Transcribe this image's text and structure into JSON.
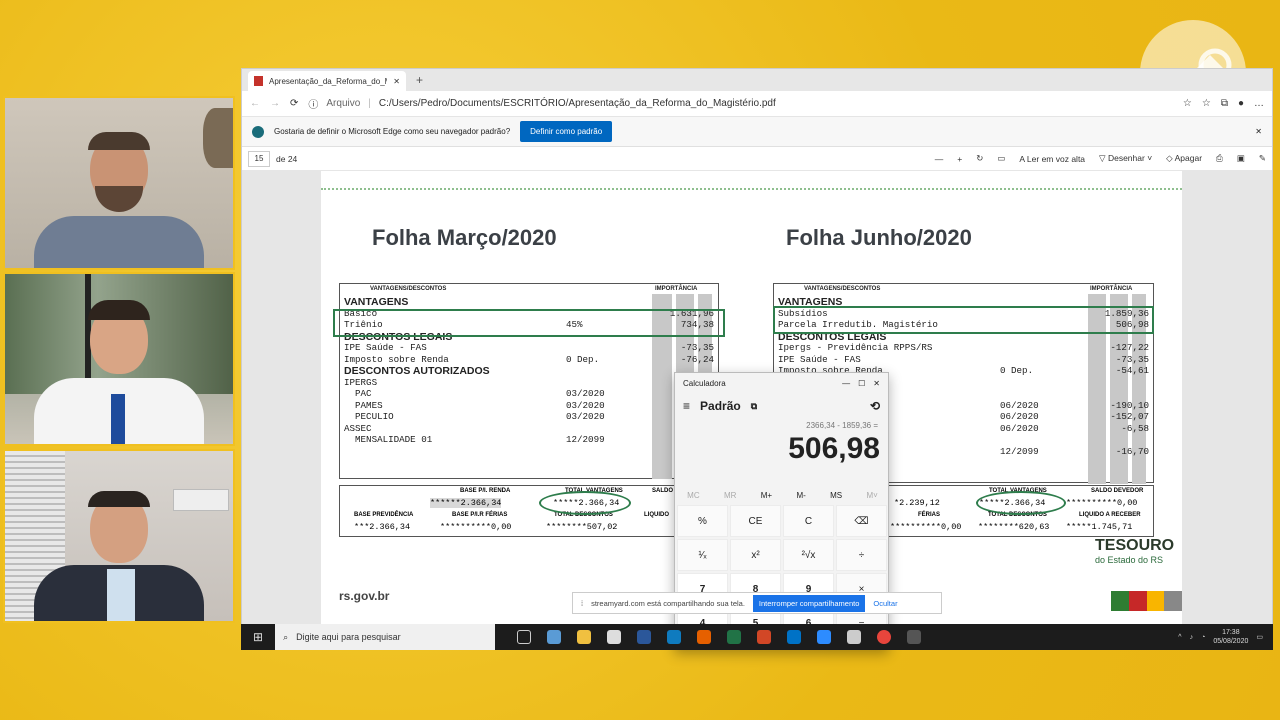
{
  "browser": {
    "tab_title": "Apresentação_da_Reforma_do_M",
    "address_label": "Arquivo",
    "address_url": "C:/Users/Pedro/Documents/ESCRITÓRIO/Apresentação_da_Reforma_do_Magistério.pdf",
    "banner_text": "Gostaria de definir o Microsoft Edge como seu navegador padrão?",
    "banner_button": "Definir como padrão"
  },
  "pdf_toolbar": {
    "page_number": "15",
    "page_total": "de 24",
    "read_aloud": "Ler em voz alta",
    "draw": "Desenhar",
    "erase": "Apagar"
  },
  "march": {
    "title": "Folha Março/2020",
    "hdr_left": "VANTAGENS/DESCONTOS",
    "hdr_right": "IMPORTÂNCIA",
    "rows": [
      {
        "t": "VANTAGENS",
        "b": true,
        "mid": "",
        "val": ""
      },
      {
        "t": "Básico",
        "b": false,
        "mid": "",
        "val": "1.631,96"
      },
      {
        "t": "Triênio",
        "b": false,
        "mid": "45%",
        "val": "734,38"
      },
      {
        "t": "DESCONTOS LEGAIS",
        "b": true,
        "mid": "",
        "val": ""
      },
      {
        "t": "IPE Saúde - FAS",
        "b": false,
        "mid": "",
        "val": "-73,35"
      },
      {
        "t": "Imposto sobre Renda",
        "b": false,
        "mid": "0 Dep.",
        "val": "-76,24"
      },
      {
        "t": "DESCONTOS AUTORIZADOS",
        "b": true,
        "mid": "",
        "val": ""
      },
      {
        "t": "IPERGS",
        "b": false,
        "mid": "",
        "val": ""
      },
      {
        "t": "  PAC",
        "b": false,
        "mid": "03/2020",
        "val": "-1"
      },
      {
        "t": "  PAMES",
        "b": false,
        "mid": "03/2020",
        "val": ""
      },
      {
        "t": "  PECULIO",
        "b": false,
        "mid": "03/2020",
        "val": ""
      },
      {
        "t": "ASSEC",
        "b": false,
        "mid": "",
        "val": ""
      },
      {
        "t": "  MENSALIDADE 01",
        "b": false,
        "mid": "12/2099",
        "val": ""
      }
    ],
    "foot": {
      "l1": "BASE P/I. RENDA",
      "v1": "******2.366,34",
      "l2": "TOTAL VANTAGENS",
      "v2": "*****2.366,34",
      "l3": "SALDO",
      "l4": "BASE PREVIDÊNCIA",
      "v4": "***2.366,34",
      "l5": "BASE P/I.R FÉRIAS",
      "v5": "**********0,00",
      "l6": "TOTAL DESCONTOS",
      "v6": "********507,02",
      "l7": "LIQUIDO"
    }
  },
  "june": {
    "title": "Folha Junho/2020",
    "hdr_left": "VANTAGENS/DESCONTOS",
    "hdr_right": "IMPORTÂNCIA",
    "rows": [
      {
        "t": "VANTAGENS",
        "b": true,
        "mid": "",
        "val": ""
      },
      {
        "t": "Subsídios",
        "b": false,
        "mid": "",
        "val": "1.859,36"
      },
      {
        "t": "Parcela Irredutib. Magistério",
        "b": false,
        "mid": "",
        "val": "506,98"
      },
      {
        "t": "DESCONTOS LEGAIS",
        "b": true,
        "mid": "",
        "val": ""
      },
      {
        "t": "Ipergs - Previdência RPPS/RS",
        "b": false,
        "mid": "",
        "val": "-127,22"
      },
      {
        "t": "IPE Saúde - FAS",
        "b": false,
        "mid": "",
        "val": "-73,35"
      },
      {
        "t": "Imposto sobre Renda",
        "b": false,
        "mid": "0 Dep.",
        "val": "-54,61"
      },
      {
        "t": "IZADOS",
        "b": true,
        "mid": "",
        "val": ""
      },
      {
        "t": "",
        "b": false,
        "mid": "",
        "val": ""
      },
      {
        "t": "",
        "b": false,
        "mid": "06/2020",
        "val": "-190,10"
      },
      {
        "t": "",
        "b": false,
        "mid": "06/2020",
        "val": "-152,07"
      },
      {
        "t": "",
        "b": false,
        "mid": "06/2020",
        "val": "-6,58"
      },
      {
        "t": "",
        "b": false,
        "mid": "",
        "val": ""
      },
      {
        "t": "",
        "b": false,
        "mid": "12/2099",
        "val": "-16,70"
      }
    ],
    "foot": {
      "l2": "TOTAL VANTAGENS",
      "v1": "*2.239,12",
      "v2": "*****2.366,34",
      "l3": "SALDO DEVEDOR",
      "v3": "**********0,00",
      "l5": "FÉRIAS",
      "v5": "**********0,00",
      "l6": "TOTAL DESCONTOS",
      "v6": "********620,63",
      "l7": "LIQUIDO A RECEBER",
      "v7": "*****1.745,71"
    }
  },
  "page_footer": {
    "site": "rs.gov.br",
    "brand": "TESOURO",
    "brand_sub": "do Estado do RS"
  },
  "calculator": {
    "title": "Calculadora",
    "mode": "Padrão",
    "expression": "2366,34 - 1859,36 =",
    "result": "506,98",
    "memory": [
      "MC",
      "MR",
      "M+",
      "M-",
      "MS",
      "M˅"
    ],
    "keys": [
      [
        "%",
        "CE",
        "C",
        "⌫"
      ],
      [
        "¹⁄ₓ",
        "x²",
        "²√x",
        "÷"
      ],
      [
        "7",
        "8",
        "9",
        "×"
      ],
      [
        "4",
        "5",
        "6",
        "−"
      ]
    ]
  },
  "share_bar": {
    "text": "streamyard.com está compartilhando sua tela.",
    "stop": "Interromper compartilhamento",
    "hide": "Ocultar"
  },
  "taskbar": {
    "search_placeholder": "Digite aqui para pesquisar",
    "time": "17:38",
    "date": "05/08/2020"
  }
}
